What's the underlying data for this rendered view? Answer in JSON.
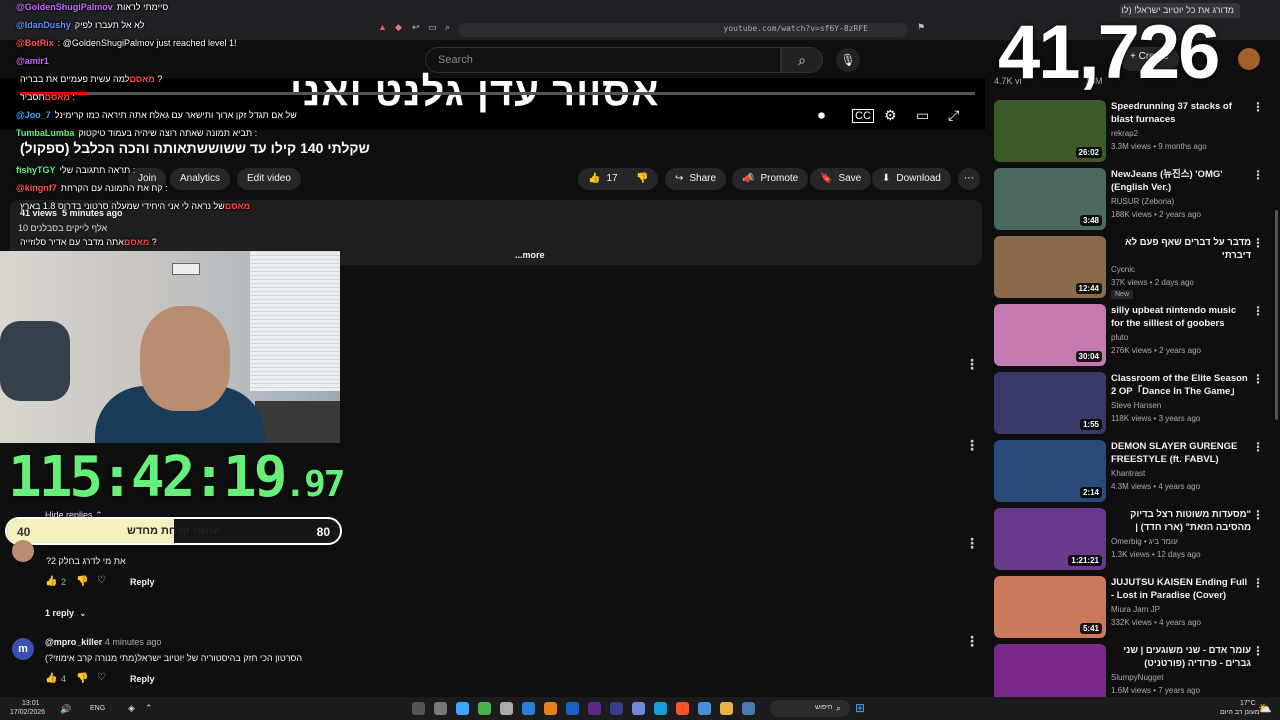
{
  "browser": {
    "tab_title": "‏מדורג את כל יוטיוב ישראל! (לו",
    "url": "youtube.com/watch?v=sf6Y-8zRFE"
  },
  "search": {
    "placeholder": "Search"
  },
  "create_label": "Create",
  "subscriber_count_partial": "4.7K vi",
  "views_partial": "18M",
  "overlay_counter": "41,726",
  "player_title": "אסוור עדן גלנט ואני",
  "player_progress_pct": 7,
  "video": {
    "title": "שקלתי 140 קילו עד ששוששתאותה והכה הכלבל (ספקול)",
    "join": "Join",
    "analytics": "Analytics",
    "edit_video": "Edit video",
    "likes": "17",
    "share": "Share",
    "promote": "Promote",
    "save": "Save",
    "download": "Download",
    "views": "41 views",
    "time_ago": "5 minutes ago",
    "description": "10 אלף לייקים בסבלנים",
    "more": "...more"
  },
  "chat": [
    {
      "user": "@GoldenShugiPalmov",
      "text": "‏סיימתי לראות",
      "color": "#c86bff"
    },
    {
      "user": "@IdanDushy",
      "text": "‏לא אל תעברו לפיק",
      "color": "#6b8cff"
    },
    {
      "user": "@BotRix",
      "text": ": @GoldenShugiPalmov just reached level 1!",
      "color": "#ff5555"
    },
    {
      "user": "@amir1",
      "text": "",
      "color": "#c86bff"
    },
    {
      "user": "‏מאסם",
      "text": "‏למה עשית פעמיים את בבריה ?",
      "color": "#ff4444"
    },
    {
      "user": "‏מאסם",
      "text": "‏תסביר :",
      "color": "#ff4444"
    },
    {
      "user": "@Joo_7",
      "text": "‏של אם תגדל זקן ארוך ותישאר עם גאלח אתה תיראה כמו קרימינל",
      "color": "#3ea6ff"
    },
    {
      "user": "TumbaLumba",
      "text": "‏תביא תמונה שאתה רוצה שיהיה בעמוד טיקטוק :",
      "color": "#66f07b"
    },
    {
      "user": "fishyTGY",
      "text": "‏תראה תתגובה שלי :",
      "color": "#66f07b"
    },
    {
      "user": "@kingnf7",
      "text": "‏קח את התמונה עם הקרחת :",
      "color": "#ff5555"
    },
    {
      "user": "‏מאסם",
      "text": "‏של נראה לי אני היחידי שמעלה סרטוני בדרוס 1.8 בארץ",
      "color": "#ff4444"
    },
    {
      "user": "‏מאסם",
      "text": "‏אתה מדבר עם אדיר סלוזייה ?",
      "color": "#ff4444"
    }
  ],
  "timer": {
    "main": "115:42:19",
    "fraction": ".97"
  },
  "goal": {
    "current": "40",
    "target": "80",
    "label": "עושה קרחת מחדש",
    "progress_pct": 50
  },
  "comments": {
    "hide_replies": "Hide replies",
    "c1_text": "את מי לדרג בחלק 2?",
    "c1_likes": "2",
    "reply": "Reply",
    "one_reply": "1 reply",
    "c2_user": "@mpro_killer",
    "c2_time": "4 minutes ago",
    "c2_text": "הסרטון הכי חזק בהיסטוריה של יוטיוב ישראל(מתי מנורה קרב אימוזי?)",
    "c2_likes": "4"
  },
  "recommendations": [
    {
      "title": "Speedrunning 37 stacks of blast furnaces",
      "channel": "rekrap2",
      "meta": "3.3M views • 9 months ago",
      "duration": "26:02",
      "thumb_color": "#3d5a2a",
      "badge": ""
    },
    {
      "title": "NewJeans (뉴진스) 'OMG' (English Ver.)",
      "channel": "RUSUR (Zeboria)",
      "meta": "188K views • 2 years ago",
      "duration": "3:48",
      "thumb_color": "#4a6a5f",
      "badge": ""
    },
    {
      "title": "‏מדבר על דברים שאף פעם לא דיברתי",
      "channel": "Cycnic",
      "meta": "37K views • 2 days ago",
      "duration": "12:44",
      "thumb_color": "#8a6a4a",
      "badge": "New"
    },
    {
      "title": "silly upbeat nintendo music for the silliest of goobers",
      "channel": "pluto",
      "meta": "276K views • 2 years ago",
      "duration": "30:04",
      "thumb_color": "#c47ab0",
      "badge": ""
    },
    {
      "title": "Classroom of the Elite Season 2 OP「Dance In The Game」ZA...",
      "channel": "Steve Hansen",
      "meta": "118K views • 3 years ago",
      "duration": "1:55",
      "thumb_color": "#3a3a6a",
      "badge": ""
    },
    {
      "title": "DEMON SLAYER GURENGE FREESTYLE (ft. FABVL)",
      "channel": "Khantrast",
      "meta": "4.3M views • 4 years ago",
      "duration": "2:14",
      "thumb_color": "#2a4a7a",
      "badge": ""
    },
    {
      "title": "\"מסעדות משוטות רצל בדיוק מהסיבה הזאת\" (ארז חדד) | אוכלים בגדול",
      "channel": "Omerbig • עומר ביג",
      "meta": "1.3K views • 12 days ago",
      "duration": "1:21:21",
      "thumb_color": "#6a3a8a",
      "badge": ""
    },
    {
      "title": "JUJUTSU KAISEN Ending Full - Lost in Paradise (Cover)",
      "channel": "Miura Jam JP",
      "meta": "332K views • 4 years ago",
      "duration": "5:41",
      "thumb_color": "#c87a5a",
      "badge": ""
    },
    {
      "title": "‏עומר אדם - שני משוגעים | שני גברים - פרודיה (פורטניט)",
      "channel": "SlumpyNugget",
      "meta": "1.6M views • 7 years ago",
      "duration": "",
      "thumb_color": "#7a2a8a",
      "badge": ""
    }
  ],
  "taskbar": {
    "time": "13:01",
    "date": "17/02/2026",
    "lang": "ENG",
    "search_label": "חיפוש",
    "weather": "17°C",
    "weather_desc": "מעונן רב היום"
  }
}
